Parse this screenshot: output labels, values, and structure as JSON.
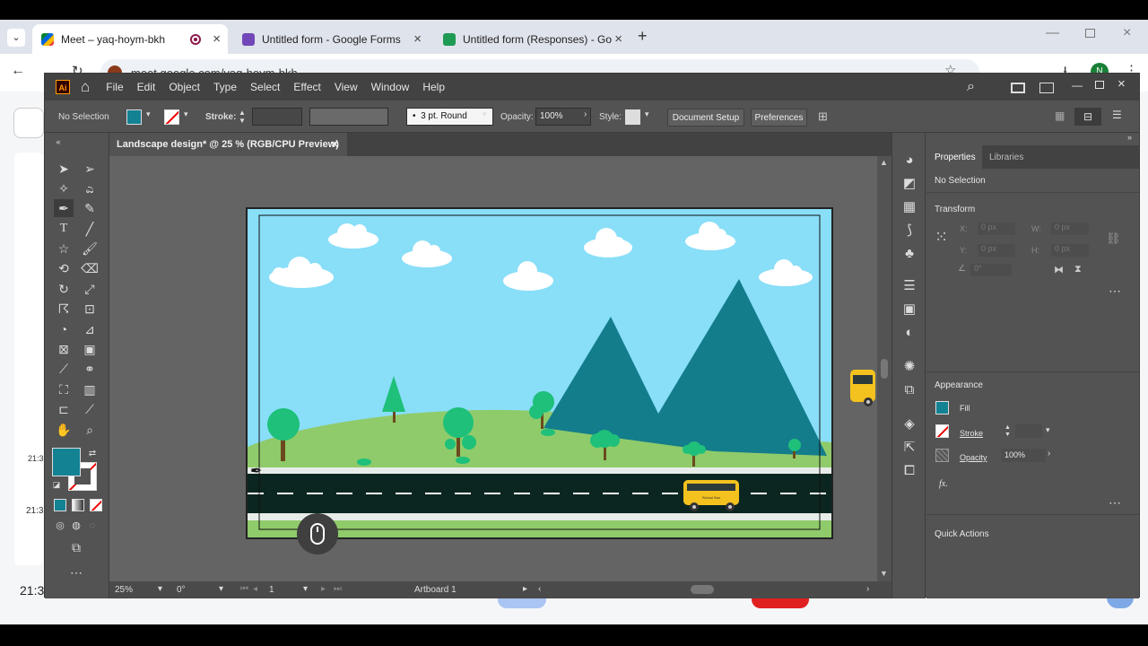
{
  "browser": {
    "tabs": [
      {
        "label": "Meet – yaq-hoym-bkh",
        "active": true
      },
      {
        "label": "Untitled form - Google Forms",
        "active": false
      },
      {
        "label": "Untitled form (Responses) - Go",
        "active": false
      }
    ],
    "url": "meet.google.com/yaq-hoym-bkh",
    "profile_initial": "N"
  },
  "meet": {
    "clock_1": "21:3",
    "clock_2": "21:3",
    "clock_3": "21:3"
  },
  "illustrator": {
    "app_badge": "Ai",
    "menus": [
      "File",
      "Edit",
      "Object",
      "Type",
      "Select",
      "Effect",
      "View",
      "Window",
      "Help"
    ],
    "control": {
      "selection": "No Selection",
      "stroke_label": "Stroke:",
      "brush": "3 pt. Round",
      "opacity_label": "Opacity:",
      "opacity_value": "100%",
      "style_label": "Style:",
      "document_setup": "Document Setup",
      "preferences": "Preferences"
    },
    "document_tab": "Landscape design* @ 25 % (RGB/CPU Preview)",
    "status": {
      "zoom": "25%",
      "rotation": "0°",
      "artboard_number": "1",
      "artboard_name": "Artboard 1"
    },
    "properties": {
      "tab_properties": "Properties",
      "tab_libraries": "Libraries",
      "selection": "No Selection",
      "transform_title": "Transform",
      "x_label": "X:",
      "y_label": "Y:",
      "w_label": "W:",
      "h_label": "H:",
      "x_value": "0 px",
      "y_value": "0 px",
      "w_value": "0 px",
      "h_value": "0 px",
      "angle_value": "0°",
      "appearance_title": "Appearance",
      "fill_label": "Fill",
      "stroke_label": "Stroke",
      "opacity_label": "Opacity",
      "opacity_value": "100%",
      "fx_label": "fx.",
      "quick_actions": "Quick Actions"
    },
    "colors": {
      "fill": "#138293",
      "sky": "#89def8",
      "grass": "#8fcb6a",
      "mountain": "#137d8c",
      "road": "#0b2620",
      "bus": "#f4c21e"
    },
    "scene_label": "School Bus"
  }
}
